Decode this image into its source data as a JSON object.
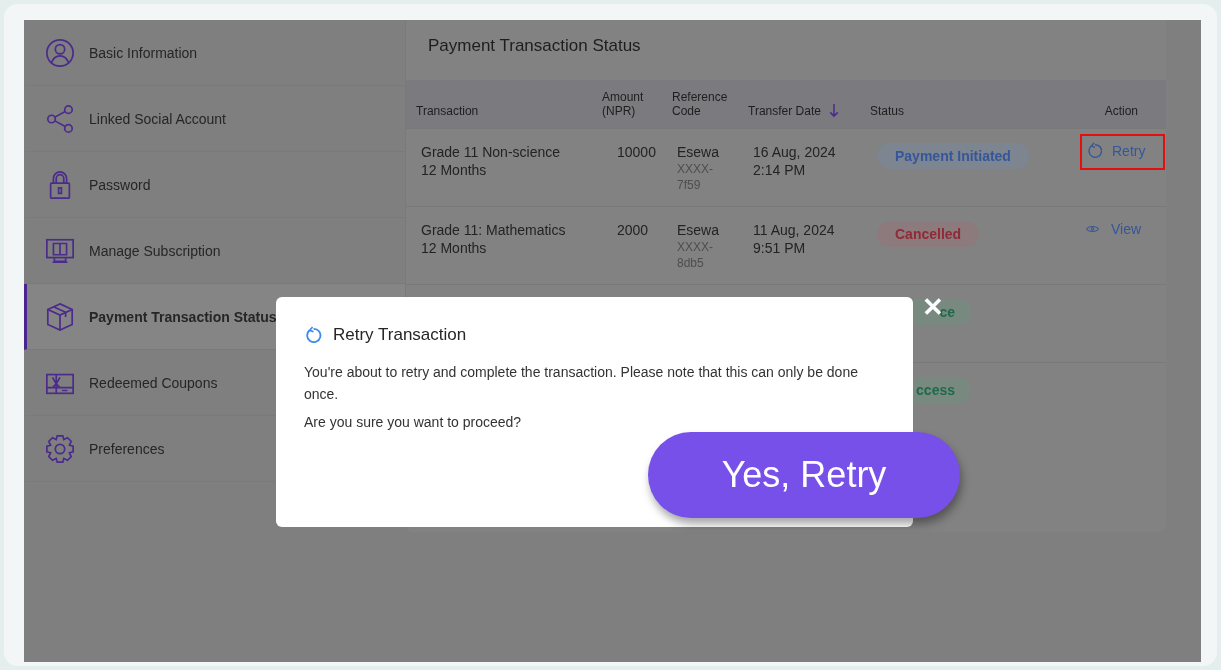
{
  "sidebar": {
    "items": [
      {
        "label": "Basic Information",
        "kind": "profile",
        "selected": false
      },
      {
        "label": "Linked Social Account",
        "kind": "social",
        "selected": false
      },
      {
        "label": "Password",
        "kind": "password",
        "selected": false
      },
      {
        "label": "Manage Subscription",
        "kind": "subscription",
        "selected": false
      },
      {
        "label": "Payment Transaction Status",
        "kind": "payment",
        "selected": true
      },
      {
        "label": "Redeemed Coupons",
        "kind": "coupons",
        "selected": false
      },
      {
        "label": "Preferences",
        "kind": "preferences",
        "selected": false
      }
    ]
  },
  "panel": {
    "title": "Payment Transaction Status",
    "table": {
      "columns": [
        {
          "label": "Transaction"
        },
        {
          "label": "Amount (NPR)"
        },
        {
          "label": "Reference Code"
        },
        {
          "label": "Transfer Date",
          "sorted": true
        },
        {
          "label": "Status"
        },
        {
          "label": "Action"
        }
      ],
      "rows": [
        {
          "transaction": "Grade 11 Non-science",
          "duration": "12 Months",
          "amount": "10000",
          "provider": "Esewa",
          "code": "XXXX-7f59",
          "date": "16 Aug, 2024",
          "time": "2:14 PM",
          "status": {
            "label": "Payment Initiated",
            "kind": "initiated"
          },
          "action": {
            "label": "Retry",
            "kind": "retry",
            "highlighted": true
          }
        },
        {
          "transaction": "Grade 11: Mathematics",
          "duration": "12 Months",
          "amount": "2000",
          "provider": "Esewa",
          "code": "XXXX-8db5",
          "date": "11 Aug, 2024",
          "time": "9:51 PM",
          "status": {
            "label": "Cancelled",
            "kind": "cancelled"
          },
          "action": {
            "label": "View",
            "kind": "view",
            "highlighted": false
          }
        },
        {
          "status": {
            "label": "ce",
            "kind": "success"
          }
        },
        {
          "status": {
            "label": "ccess",
            "kind": "success"
          }
        }
      ]
    }
  },
  "dialog": {
    "title": "Retry Transaction",
    "message": "You're about to retry and complete the transaction. Please note that this can only be done once.",
    "question": "Are you sure you want to proceed?",
    "confirm": "Yes, Retry",
    "close": "✕"
  }
}
